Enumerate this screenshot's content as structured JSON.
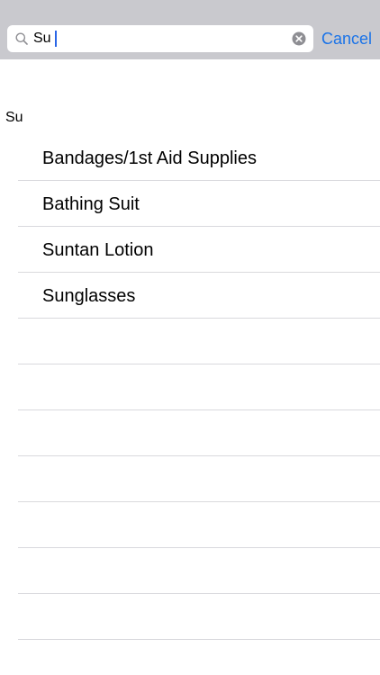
{
  "search": {
    "value": "Su",
    "cancel_label": "Cancel"
  },
  "section": {
    "header": "Su"
  },
  "results": [
    {
      "label": "Bandages/1st Aid Supplies"
    },
    {
      "label": "Bathing Suit"
    },
    {
      "label": "Suntan Lotion"
    },
    {
      "label": "Sunglasses"
    },
    {
      "label": ""
    },
    {
      "label": ""
    },
    {
      "label": ""
    },
    {
      "label": ""
    },
    {
      "label": ""
    },
    {
      "label": ""
    },
    {
      "label": ""
    }
  ],
  "colors": {
    "search_bar_bg": "#c9c9ce",
    "accent": "#1a73e8",
    "separator": "#d9d9dd"
  }
}
